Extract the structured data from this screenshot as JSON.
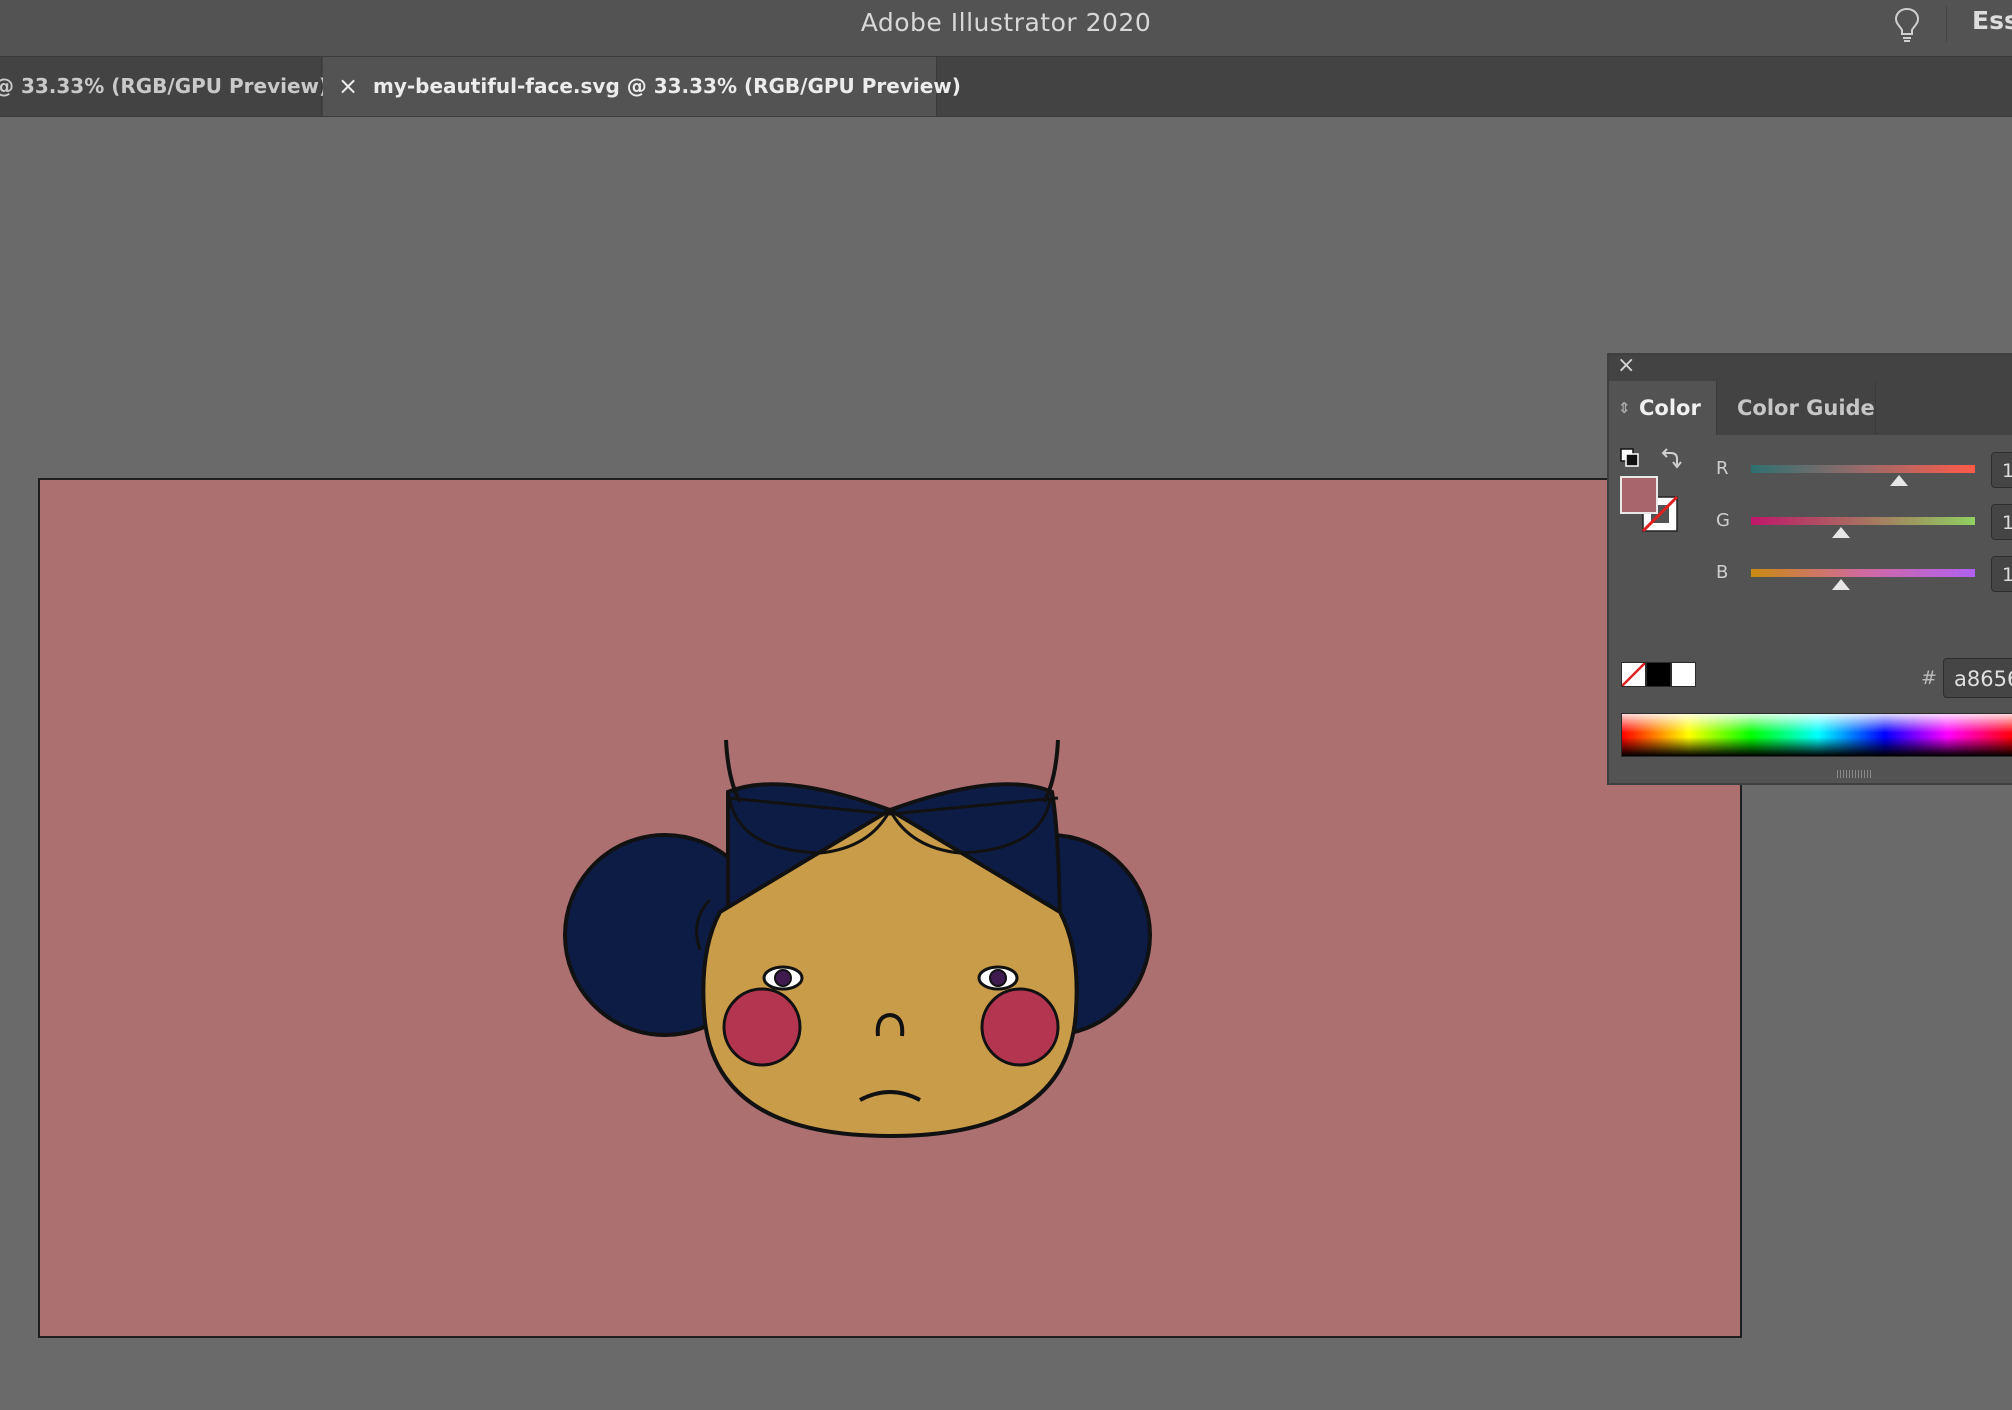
{
  "app": {
    "title": "Adobe Illustrator 2020",
    "workspace_label": "Ess",
    "icons": {
      "bulb": "lightbulb-icon"
    }
  },
  "tabs": [
    {
      "label": "@ 33.33% (RGB/GPU Preview)",
      "active": false
    },
    {
      "label": "my-beautiful-face.svg @ 33.33% (RGB/GPU Preview)",
      "active": true,
      "close_glyph": "×"
    }
  ],
  "artboard": {
    "background_color": "#ad7070",
    "illustration": {
      "hair_color": "#0c1c45",
      "skin_color": "#c99c4a",
      "cheek_color": "#b3354f",
      "iris_color": "#3f1a4f",
      "outline_color": "#111111"
    }
  },
  "color_panel": {
    "close_glyph": "×",
    "tabs": [
      "Color",
      "Color Guide"
    ],
    "active_tab": "Color",
    "fill_color": "#a8656b",
    "channels": [
      {
        "label": "R",
        "value": "1",
        "level": 0.66
      },
      {
        "label": "G",
        "value": "1",
        "level": 0.4
      },
      {
        "label": "B",
        "value": "1",
        "level": 0.4
      }
    ],
    "hex_label": "#",
    "hex_value": "a8656"
  }
}
